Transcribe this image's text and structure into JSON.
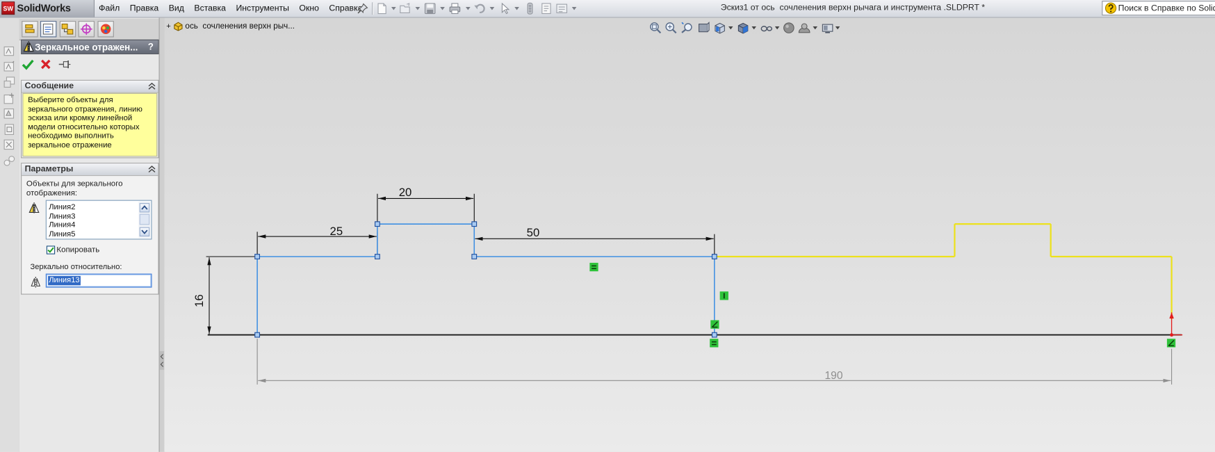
{
  "app": {
    "logo_badge": "SW",
    "logo_text": "SolidWorks"
  },
  "menu": {
    "items": [
      "Файл",
      "Правка",
      "Вид",
      "Вставка",
      "Инструменты",
      "Окно",
      "Справка"
    ]
  },
  "window": {
    "title": "Эскиз1 от ось  сочленения верхн рычага и инструмента .SLDPRT *"
  },
  "search": {
    "placeholder": "Поиск в Справке по SolidWo"
  },
  "feature_tree": {
    "expand": "+",
    "item": "ось  сочленения верхн рыч..."
  },
  "property_manager": {
    "title": "Зеркальное отражен...",
    "help": "?",
    "message": {
      "title": "Сообщение",
      "text": "Выберите объекты для зеркального отражения, линию эскиза или кромку линейной модели относительно которых необходимо выполнить зеркальное отражение"
    },
    "parameters": {
      "title": "Параметры",
      "entities_label": "Объекты для зеркального отображения:",
      "entities": [
        "Линия2",
        "Линия3",
        "Линия4",
        "Линия5"
      ],
      "copy_label": "Копировать",
      "copy_checked": true,
      "mirror_about_label": "Зеркально относительно:",
      "mirror_about_value": "Линия13"
    }
  },
  "sketch": {
    "dimensions": {
      "d25": "25",
      "d20": "20",
      "d50": "50",
      "d16": "16",
      "d190": "190"
    },
    "colors": {
      "sketch_line": "#3f8fe2",
      "mirror_preview": "#ece11c",
      "centerline": "#1a1a1a",
      "driven_dimension": "#8e8e8e",
      "relation": "#2fc23b",
      "origin": "#e21d1d"
    }
  }
}
